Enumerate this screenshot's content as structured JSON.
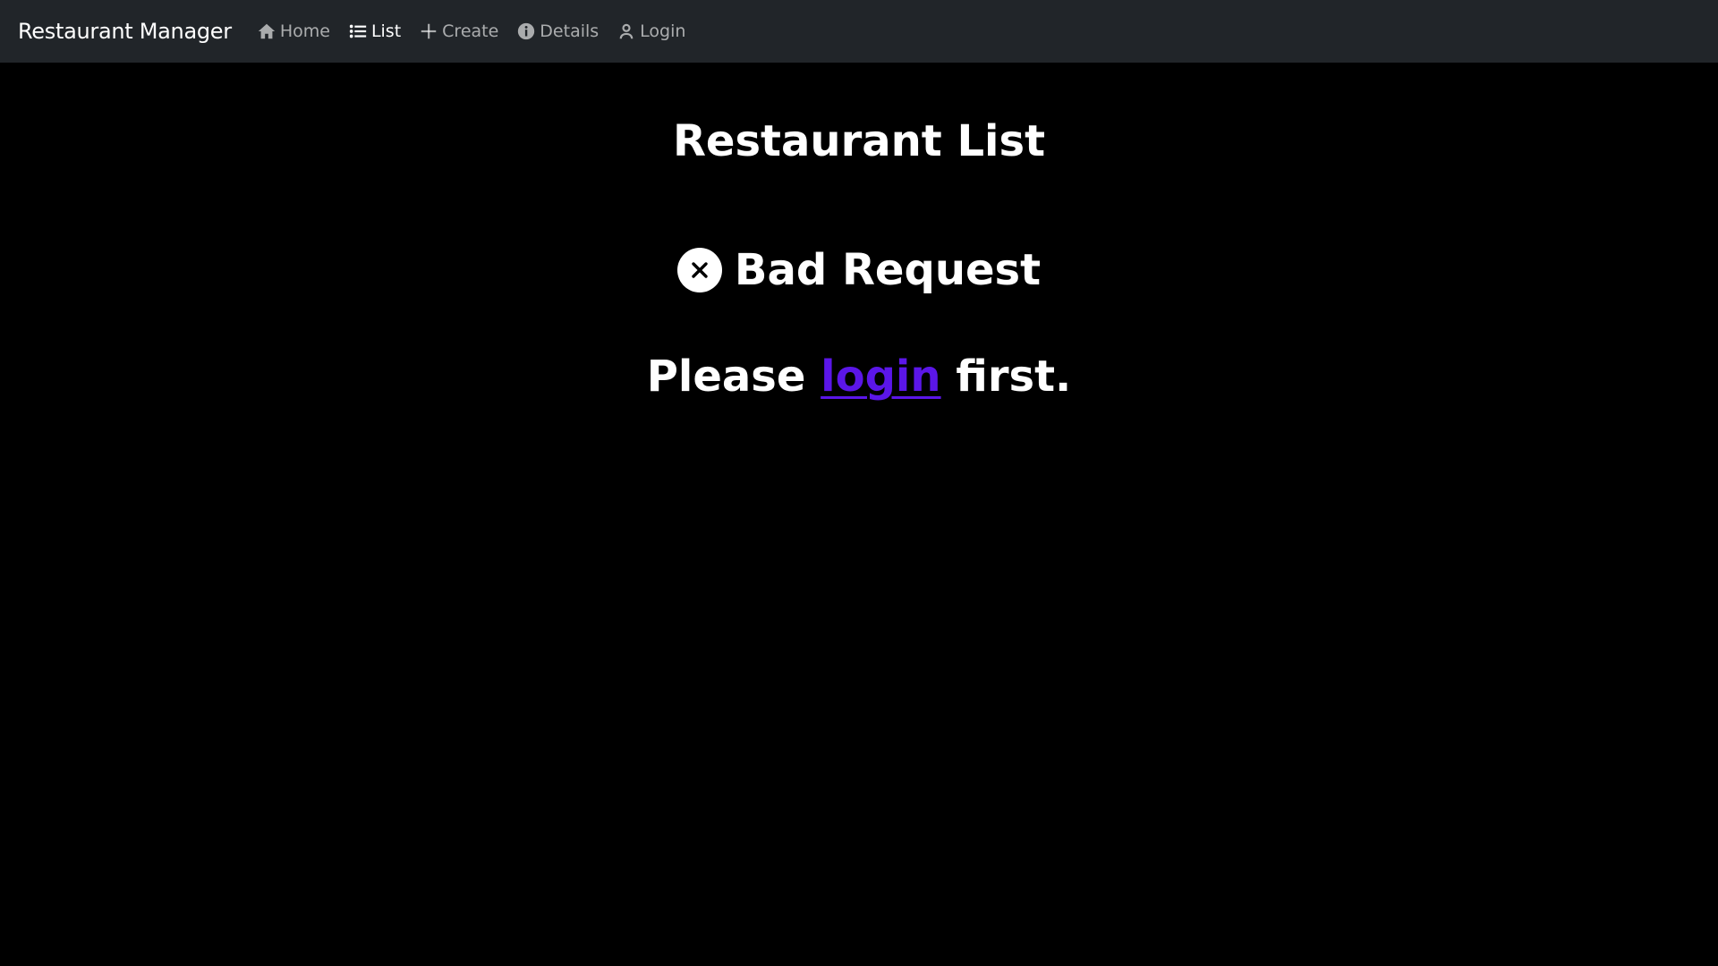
{
  "navbar": {
    "brand": "Restaurant Manager",
    "links": [
      {
        "label": "Home",
        "icon": "home-icon"
      },
      {
        "label": "List",
        "icon": "list-icon",
        "active": true
      },
      {
        "label": "Create",
        "icon": "plus-icon"
      },
      {
        "label": "Details",
        "icon": "info-icon"
      },
      {
        "label": "Login",
        "icon": "user-icon"
      }
    ]
  },
  "main": {
    "title": "Restaurant List",
    "error": {
      "icon": "close-circle-icon",
      "text": "Bad Request"
    },
    "message": {
      "prefix": "Please ",
      "link": "login",
      "suffix": " first."
    }
  },
  "colors": {
    "background": "#000000",
    "navbar": "#212529",
    "link": "#5b16e8",
    "nav_inactive": "#9da0a3"
  }
}
